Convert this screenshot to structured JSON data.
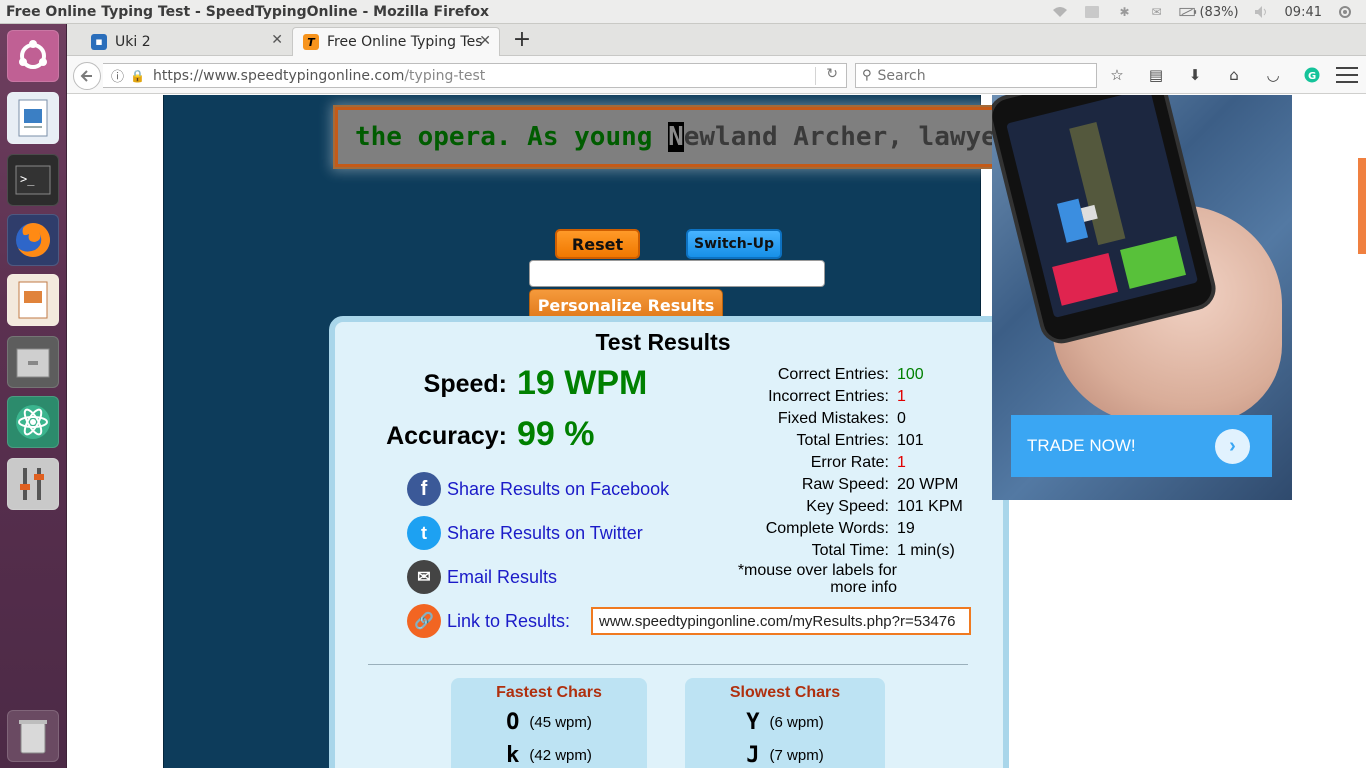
{
  "window_title": "Free Online Typing Test - SpeedTypingOnline - Mozilla Firefox",
  "indicators": {
    "battery": "(83%)",
    "clock": "09:41"
  },
  "tabs": [
    {
      "label": "Uki 2",
      "active": false
    },
    {
      "label": "Free Online Typing Tes",
      "active": true
    }
  ],
  "url": {
    "host": "https://www.speedtypingonline.com",
    "path": "/typing-test"
  },
  "search": {
    "placeholder": "Search"
  },
  "typing_text": {
    "typed": "the opera. As young ",
    "cursor": "N",
    "rest": "ewland Archer, lawyer"
  },
  "buttons": {
    "reset": "Reset",
    "switch": "Switch-Up",
    "personalize": "Personalize Results"
  },
  "results": {
    "title": "Test Results",
    "speed_label": "Speed:",
    "speed_value": "19 WPM",
    "accuracy_label": "Accuracy:",
    "accuracy_value": "99 %",
    "share": {
      "facebook": "Share Results on Facebook",
      "twitter": "Share Results on Twitter",
      "email": "Email Results",
      "link": "Link to Results:"
    },
    "link_url": "www.speedtypingonline.com/myResults.php?r=53476",
    "stats": [
      {
        "label": "Correct Entries:",
        "value": "100"
      },
      {
        "label": "Incorrect Entries:",
        "value": "1"
      },
      {
        "label": "Fixed Mistakes:",
        "value": "0"
      },
      {
        "label": "Total Entries:",
        "value": "101"
      },
      {
        "label": "Error Rate:",
        "value": "1"
      },
      {
        "label": "Raw Speed:",
        "value": "20 WPM"
      },
      {
        "label": "Key Speed:",
        "value": "101 KPM"
      },
      {
        "label": "Complete Words:",
        "value": "19"
      },
      {
        "label": "Total Time:",
        "value": "1 min(s)"
      }
    ],
    "note": "*mouse over labels for more info",
    "fastest": {
      "title": "Fastest Chars",
      "rows": [
        {
          "char": "O",
          "wpm": "(45 wpm)"
        },
        {
          "char": "k",
          "wpm": "(42 wpm)"
        }
      ]
    },
    "slowest": {
      "title": "Slowest Chars",
      "rows": [
        {
          "char": "Y",
          "wpm": "(6 wpm)"
        },
        {
          "char": "J",
          "wpm": "(7 wpm)"
        }
      ]
    }
  },
  "ad": {
    "cta": "TRADE NOW!"
  },
  "colors": {
    "accent_orange": "#f07800",
    "accent_blue": "#1790e8",
    "panel": "#0d3c5b",
    "good": "#008000",
    "bad": "#e00000"
  }
}
